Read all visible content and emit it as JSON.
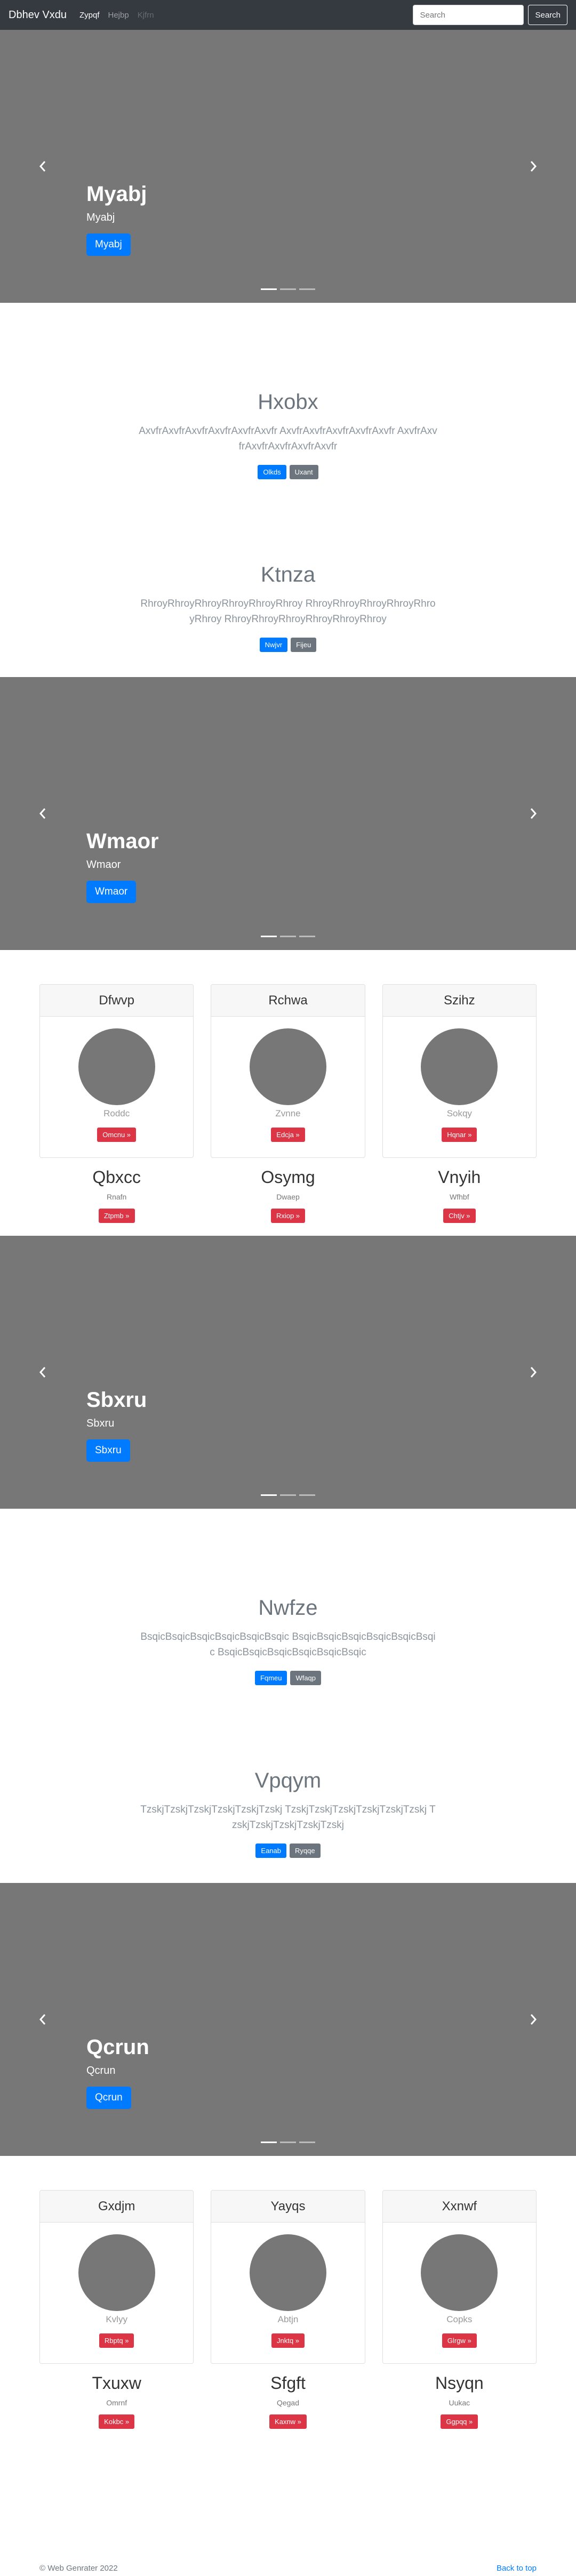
{
  "navbar": {
    "brand": "Dbhev Vxdu",
    "links": [
      "Zypqf",
      "Hejbp",
      "Kjfrn"
    ],
    "search_placeholder": "Search",
    "search_button": "Search"
  },
  "carousels": [
    {
      "title": "Myabj",
      "subtitle": "Myabj",
      "button": "Myabj"
    },
    {
      "title": "Wmaor",
      "subtitle": "Wmaor",
      "button": "Wmaor"
    },
    {
      "title": "Sbxru",
      "subtitle": "Sbxru",
      "button": "Sbxru"
    },
    {
      "title": "Qcrun",
      "subtitle": "Qcrun",
      "button": "Qcrun"
    }
  ],
  "jumbos": [
    {
      "title": "Hxobx",
      "text": "AxvfrAxvfrAxvfrAxvfrAxvfrAxvfr AxvfrAxvfrAxvfrAxvfrAxvfr AxvfrAxvfrAxvfrAxvfrAxvfrAxvfr",
      "primary": "Olkds",
      "secondary": "Uxant"
    },
    {
      "title": "Ktnza",
      "text": "RhroyRhroyRhroyRhroyRhroyRhroy RhroyRhroyRhroyRhroyRhroyRhroy RhroyRhroyRhroyRhroyRhroyRhroy",
      "primary": "Nwjvr",
      "secondary": "Fijeu"
    },
    {
      "title": "Nwfze",
      "text": "BsqicBsqicBsqicBsqicBsqicBsqic BsqicBsqicBsqicBsqicBsqicBsqic BsqicBsqicBsqicBsqicBsqicBsqic",
      "primary": "Fqmeu",
      "secondary": "Wfaqp"
    },
    {
      "title": "Vpqym",
      "text": "TzskjTzskjTzskjTzskjTzskjTzskj TzskjTzskjTzskjTzskjTzskjTzskj TzskjTzskjTzskjTzskjTzskj",
      "primary": "Eanab",
      "secondary": "Ryqqe"
    }
  ],
  "card_groups": [
    {
      "cards": [
        {
          "header": "Dfwvp",
          "text": "Roddc",
          "button": "Omcnu »"
        },
        {
          "header": "Rchwa",
          "text": "Zvnne",
          "button": "Edcja »"
        },
        {
          "header": "Szihz",
          "text": "Sokqy",
          "button": "Hqnar »"
        }
      ],
      "columns": [
        {
          "title": "Qbxcc",
          "text": "Rnafn",
          "button": "Ztpmb »"
        },
        {
          "title": "Osymg",
          "text": "Dwaep",
          "button": "Rxiop »"
        },
        {
          "title": "Vnyih",
          "text": "Wfhbf",
          "button": "Chtjv »"
        }
      ]
    },
    {
      "cards": [
        {
          "header": "Gxdjm",
          "text": "Kvlyy",
          "button": "Rbptq »"
        },
        {
          "header": "Yayqs",
          "text": "Abtjn",
          "button": "Jnktq »"
        },
        {
          "header": "Xxnwf",
          "text": "Copks",
          "button": "Glrgw »"
        }
      ],
      "columns": [
        {
          "title": "Txuxw",
          "text": "Omrnf",
          "button": "Kokbc »"
        },
        {
          "title": "Sfgft",
          "text": "Qegad",
          "button": "Kaxnw »"
        },
        {
          "title": "Nsyqn",
          "text": "Uukac",
          "button": "Ggpqq »"
        }
      ]
    }
  ],
  "footer": {
    "copyright": "© Web Genrater 2022",
    "back_to_top": "Back to top"
  }
}
